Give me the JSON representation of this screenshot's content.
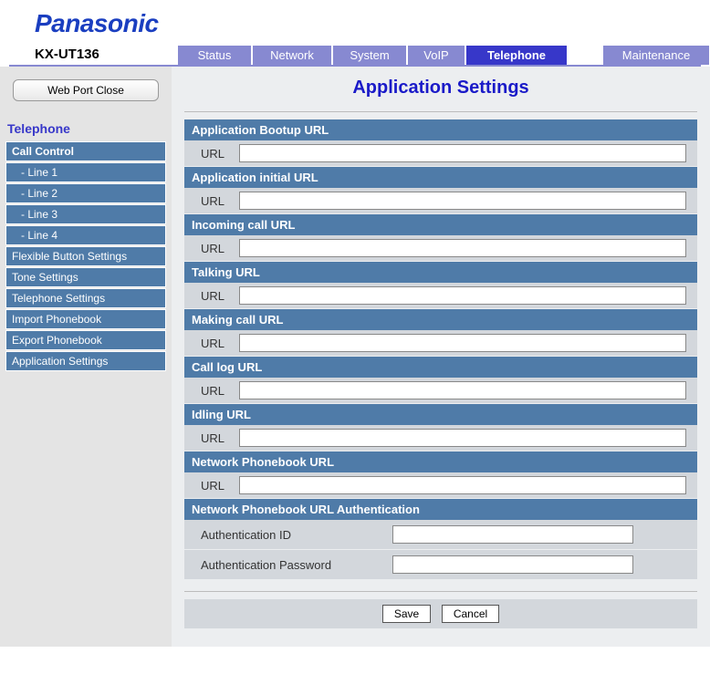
{
  "brand": "Panasonic",
  "model": "KX-UT136",
  "tabs": {
    "status": "Status",
    "network": "Network",
    "system": "System",
    "voip": "VoIP",
    "telephone": "Telephone",
    "maintenance": "Maintenance"
  },
  "sidebar": {
    "webport_btn": "Web Port Close",
    "title": "Telephone",
    "items": [
      "Call Control",
      "  - Line 1",
      "  - Line 2",
      "  - Line 3",
      "  - Line 4",
      "Flexible Button Settings",
      "Tone Settings",
      "Telephone Settings",
      "Import Phonebook",
      "Export Phonebook",
      "Application Settings"
    ]
  },
  "page_title": "Application Settings",
  "sections": {
    "bootup": {
      "header": "Application Bootup URL",
      "label": "URL",
      "value": ""
    },
    "initial": {
      "header": "Application initial URL",
      "label": "URL",
      "value": ""
    },
    "incoming": {
      "header": "Incoming call URL",
      "label": "URL",
      "value": ""
    },
    "talking": {
      "header": "Talking URL",
      "label": "URL",
      "value": ""
    },
    "making": {
      "header": "Making call URL",
      "label": "URL",
      "value": ""
    },
    "calllog": {
      "header": "Call log URL",
      "label": "URL",
      "value": ""
    },
    "idling": {
      "header": "Idling URL",
      "label": "URL",
      "value": ""
    },
    "phonebook": {
      "header": "Network Phonebook URL",
      "label": "URL",
      "value": ""
    },
    "auth": {
      "header": "Network Phonebook URL Authentication",
      "id_label": "Authentication ID",
      "id_value": "",
      "pw_label": "Authentication Password",
      "pw_value": ""
    }
  },
  "buttons": {
    "save": "Save",
    "cancel": "Cancel"
  }
}
